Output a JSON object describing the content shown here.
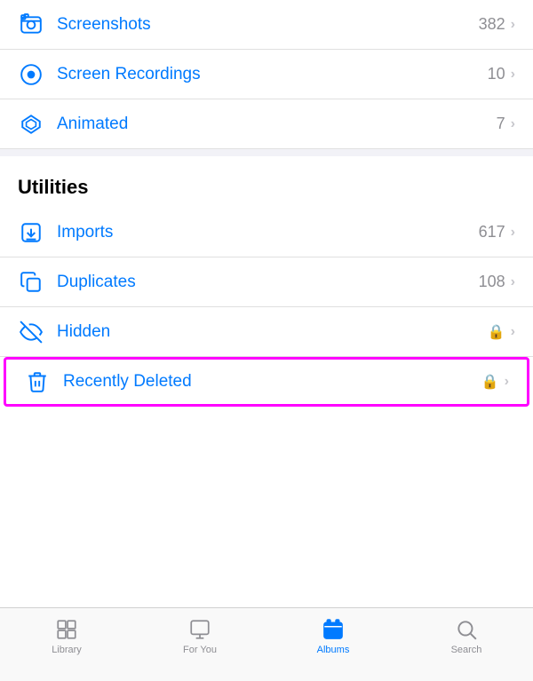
{
  "items_top": [
    {
      "id": "screenshots",
      "label": "Screenshots",
      "count": "382",
      "hasLock": false,
      "icon": "screenshots"
    },
    {
      "id": "screen-recordings",
      "label": "Screen Recordings",
      "count": "10",
      "hasLock": false,
      "icon": "screen-recordings"
    },
    {
      "id": "animated",
      "label": "Animated",
      "count": "7",
      "hasLock": false,
      "icon": "animated"
    }
  ],
  "section_utilities": "Utilities",
  "items_utilities": [
    {
      "id": "imports",
      "label": "Imports",
      "count": "617",
      "hasLock": false,
      "icon": "imports"
    },
    {
      "id": "duplicates",
      "label": "Duplicates",
      "count": "108",
      "hasLock": false,
      "icon": "duplicates"
    },
    {
      "id": "hidden",
      "label": "Hidden",
      "count": "",
      "hasLock": true,
      "icon": "hidden"
    },
    {
      "id": "recently-deleted",
      "label": "Recently Deleted",
      "count": "",
      "hasLock": true,
      "icon": "recently-deleted",
      "highlighted": true
    }
  ],
  "tabs": [
    {
      "id": "library",
      "label": "Library",
      "active": false
    },
    {
      "id": "for-you",
      "label": "For You",
      "active": false
    },
    {
      "id": "albums",
      "label": "Albums",
      "active": true
    },
    {
      "id": "search",
      "label": "Search",
      "active": false
    }
  ]
}
